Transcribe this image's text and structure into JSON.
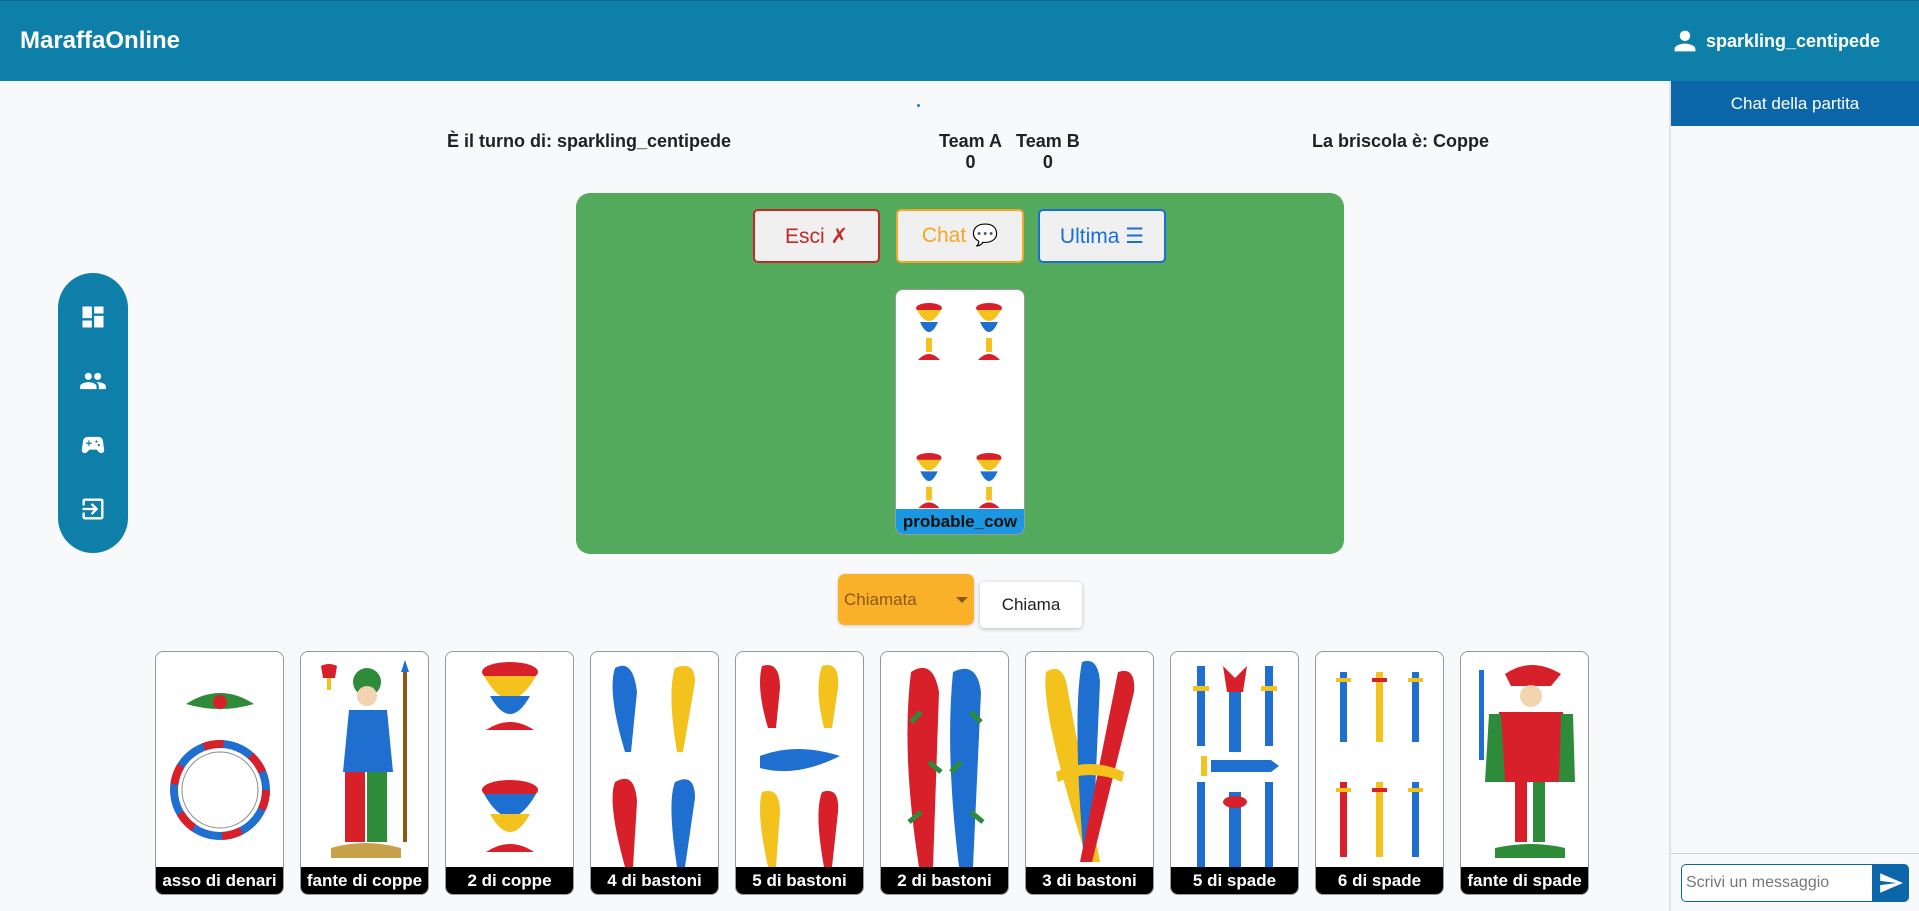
{
  "app": {
    "title": "MaraffaOnline"
  },
  "user": {
    "name": "sparkling_centipede",
    "icon": "person-icon"
  },
  "nav": {
    "items": [
      {
        "name": "dashboard",
        "icon": "dashboard-icon"
      },
      {
        "name": "players",
        "icon": "people-icon"
      },
      {
        "name": "game",
        "icon": "gamepad-icon"
      },
      {
        "name": "logout",
        "icon": "logout-icon"
      }
    ]
  },
  "info": {
    "turn": "È il turno di: sparkling_centipede",
    "teams": [
      {
        "name": "Team A",
        "score": "0"
      },
      {
        "name": "Team B",
        "score": "0"
      }
    ],
    "briscola": "La briscola è: Coppe"
  },
  "table": {
    "buttons": {
      "esci": "Esci ✗",
      "chat": "Chat 💬",
      "ultima": "Ultima ☰"
    },
    "played_card": {
      "suit": "coppe",
      "value": 4,
      "owner": "probable_cow"
    }
  },
  "call": {
    "select_value": "Chiamata",
    "button": "Chiama"
  },
  "hand": [
    {
      "label": "asso di denari",
      "suit": "denari"
    },
    {
      "label": "fante di coppe",
      "suit": "coppe"
    },
    {
      "label": "2 di coppe",
      "suit": "coppe"
    },
    {
      "label": "4 di bastoni",
      "suit": "bastoni"
    },
    {
      "label": "5 di bastoni",
      "suit": "bastoni"
    },
    {
      "label": "2 di bastoni",
      "suit": "bastoni"
    },
    {
      "label": "3 di bastoni",
      "suit": "bastoni"
    },
    {
      "label": "5 di spade",
      "suit": "spade"
    },
    {
      "label": "6 di spade",
      "suit": "spade"
    },
    {
      "label": "fante di spade",
      "suit": "spade"
    }
  ],
  "chat": {
    "title": "Chat della partita",
    "placeholder": "Scrivi un messaggio",
    "send_icon": "send-icon"
  },
  "colors": {
    "primary": "#0d7fa8",
    "table": "#53a95c",
    "esci": "#c62828",
    "chat": "#f5a623",
    "ultima": "#1a6ed8",
    "select": "#fbb02a"
  }
}
